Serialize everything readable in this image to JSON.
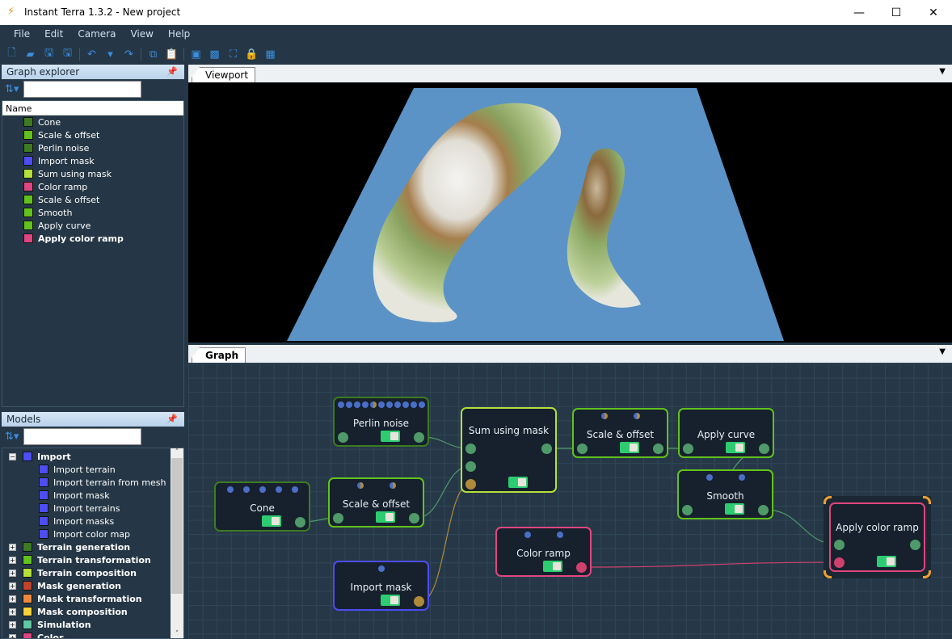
{
  "window": {
    "title": "Instant Terra 1.3.2 - New project",
    "minimize": "—",
    "maximize": "☐",
    "close": "✕"
  },
  "menu": [
    "File",
    "Edit",
    "Camera",
    "View",
    "Help"
  ],
  "toolbar": [
    {
      "icon": "new-file-icon",
      "g": "🗋"
    },
    {
      "icon": "open-icon",
      "g": "▰"
    },
    {
      "icon": "save-icon",
      "g": "🖫"
    },
    {
      "icon": "save-as-icon",
      "g": "🖫"
    },
    {
      "sep": true
    },
    {
      "icon": "undo-icon",
      "g": "↶"
    },
    {
      "icon": "undo-dropdown-icon",
      "g": "▾"
    },
    {
      "icon": "redo-icon",
      "g": "↷"
    },
    {
      "sep": true
    },
    {
      "icon": "copy-icon",
      "g": "⧉"
    },
    {
      "icon": "paste-icon",
      "g": "📋"
    },
    {
      "sep": true
    },
    {
      "icon": "box-view-icon",
      "g": "▣"
    },
    {
      "icon": "texture-icon",
      "g": "▩"
    },
    {
      "icon": "fullscreen-icon",
      "g": "⛶"
    },
    {
      "icon": "lock-icon",
      "g": "🔒"
    },
    {
      "icon": "color-ramp-icon",
      "g": "▦"
    }
  ],
  "graph_explorer": {
    "title": "Graph explorer",
    "column": "Name",
    "search_placeholder": "",
    "items": [
      {
        "label": "Cone",
        "color": "#3d7a22"
      },
      {
        "label": "Scale & offset",
        "color": "#62c21c"
      },
      {
        "label": "Perlin noise",
        "color": "#3d7a22"
      },
      {
        "label": "Import mask",
        "color": "#4d4df5"
      },
      {
        "label": "Sum using mask",
        "color": "#b5e03a"
      },
      {
        "label": "Color ramp",
        "color": "#e0457f"
      },
      {
        "label": "Scale & offset",
        "color": "#62c21c"
      },
      {
        "label": "Smooth",
        "color": "#62c21c"
      },
      {
        "label": "Apply curve",
        "color": "#62c21c"
      },
      {
        "label": "Apply color ramp",
        "color": "#e0457f",
        "bold": true
      }
    ]
  },
  "models": {
    "title": "Models",
    "search_placeholder": "",
    "groups": [
      {
        "label": "Import",
        "color": "#4d4df5",
        "expanded": true,
        "children": [
          "Import terrain",
          "Import terrain from mesh",
          "Import mask",
          "Import terrains",
          "Import masks",
          "Import color map"
        ]
      },
      {
        "label": "Terrain generation",
        "color": "#3d7a22"
      },
      {
        "label": "Terrain transformation",
        "color": "#62c21c"
      },
      {
        "label": "Terrain composition",
        "color": "#b5e03a"
      },
      {
        "label": "Mask generation",
        "color": "#c0432a"
      },
      {
        "label": "Mask transformation",
        "color": "#f0883a"
      },
      {
        "label": "Mask composition",
        "color": "#f8d03a"
      },
      {
        "label": "Simulation",
        "color": "#5ec8a0"
      },
      {
        "label": "Color",
        "color": "#e0457f"
      }
    ]
  },
  "viewport": {
    "tab": "Viewport",
    "water": "#5b93c7",
    "background": "#000000"
  },
  "graph": {
    "tab": "Graph",
    "nodes": [
      {
        "id": "perlin",
        "label": "Perlin noise",
        "color": "#3d7a22",
        "dots": "bbbbhbbbbbb",
        "enabled": true
      },
      {
        "id": "sum",
        "label": "Sum using mask",
        "color": "#b5e03a",
        "dots": "",
        "enabled": true
      },
      {
        "id": "scale1",
        "label": "Scale & offset",
        "color": "#62c21c",
        "dots": "hh",
        "enabled": true
      },
      {
        "id": "cone",
        "label": "Cone",
        "color": "#3d7a22",
        "dots": "bbbbb",
        "enabled": true
      },
      {
        "id": "scale2",
        "label": "Scale & offset",
        "color": "#62c21c",
        "dots": "hh",
        "enabled": true
      },
      {
        "id": "curve",
        "label": "Apply curve",
        "color": "#62c21c",
        "dots": "",
        "enabled": true
      },
      {
        "id": "smooth",
        "label": "Smooth",
        "color": "#62c21c",
        "dots": "bb",
        "enabled": true
      },
      {
        "id": "ramp",
        "label": "Color ramp",
        "color": "#e0457f",
        "dots": "bb",
        "enabled": true
      },
      {
        "id": "mask",
        "label": "Import mask",
        "color": "#4d4df5",
        "dots": "b",
        "enabled": true
      },
      {
        "id": "acr",
        "label": "Apply color ramp",
        "color": "#e0457f",
        "dots": "",
        "enabled": true,
        "selected": true
      }
    ],
    "edges": [
      [
        "perlin",
        "sum"
      ],
      [
        "cone",
        "scale1"
      ],
      [
        "scale1",
        "sum"
      ],
      [
        "mask",
        "sum"
      ],
      [
        "sum",
        "scale2"
      ],
      [
        "scale2",
        "curve"
      ],
      [
        "curve",
        "smooth"
      ],
      [
        "smooth",
        "acr"
      ],
      [
        "ramp",
        "acr"
      ]
    ],
    "port_colors": {
      "terrain": "#4f9a68",
      "mask": "#b08a3a",
      "color": "#d0406e"
    }
  }
}
